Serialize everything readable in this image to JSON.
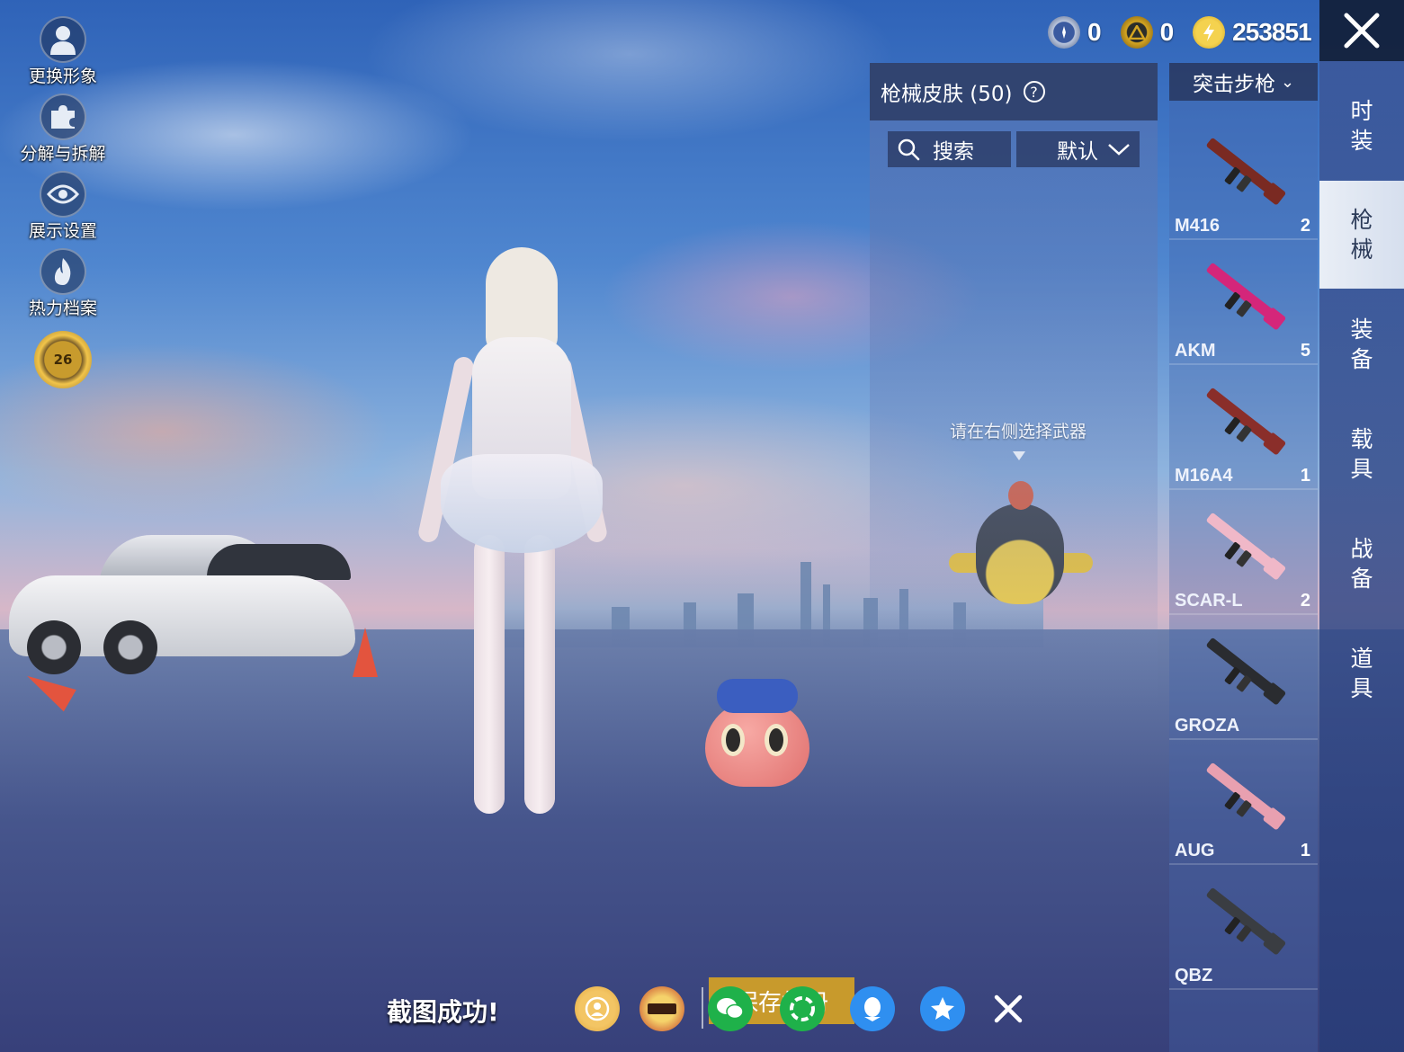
{
  "left_menu": {
    "items": [
      {
        "label": "更换形象",
        "icon": "avatar-icon"
      },
      {
        "label": "分解与拆解",
        "icon": "puzzle-icon"
      },
      {
        "label": "展示设置",
        "icon": "eye-icon"
      },
      {
        "label": "热力档案",
        "icon": "flame-icon"
      }
    ],
    "rank_level": "26"
  },
  "currency": [
    {
      "icon": "coupon-icon",
      "value": "0"
    },
    {
      "icon": "token-icon",
      "value": "0"
    },
    {
      "icon": "lightning-coin-icon",
      "value": "253851"
    }
  ],
  "category_tabs": [
    {
      "label": "时装",
      "active": false
    },
    {
      "label": "枪械",
      "active": true
    },
    {
      "label": "装备",
      "active": false
    },
    {
      "label": "载具",
      "active": false
    },
    {
      "label": "战备",
      "active": false
    },
    {
      "label": "道具",
      "active": false
    }
  ],
  "skin_panel": {
    "title": "枪械皮肤 (50)",
    "search_label": "搜索",
    "sort_label": "默认",
    "hint": "请在右侧选择武器"
  },
  "weapon_list": {
    "type_label": "突击步枪",
    "items": [
      {
        "name": "M416",
        "count": "2",
        "color": "#7a2a22"
      },
      {
        "name": "AKM",
        "count": "5",
        "color": "#d4267a"
      },
      {
        "name": "M16A4",
        "count": "1",
        "color": "#8a2e2a"
      },
      {
        "name": "SCAR-L",
        "count": "2",
        "color": "#f0b8c8"
      },
      {
        "name": "GROZA",
        "count": "",
        "color": "#2a2c30"
      },
      {
        "name": "AUG",
        "count": "1",
        "color": "#e8a0b0"
      },
      {
        "name": "QBZ",
        "count": "",
        "color": "#3a3d42"
      }
    ]
  },
  "share_bar": {
    "status": "截图成功!",
    "save_label": "保存相册",
    "icons": [
      "heping-friends-icon",
      "game-logo-icon",
      "wechat-icon",
      "moments-icon",
      "qq-icon",
      "qzone-icon",
      "close-icon"
    ]
  },
  "colors": {
    "accent_gold": "#c89a2c",
    "panel_dark": "#2d3c64",
    "active_tab": "#e9eef6"
  }
}
